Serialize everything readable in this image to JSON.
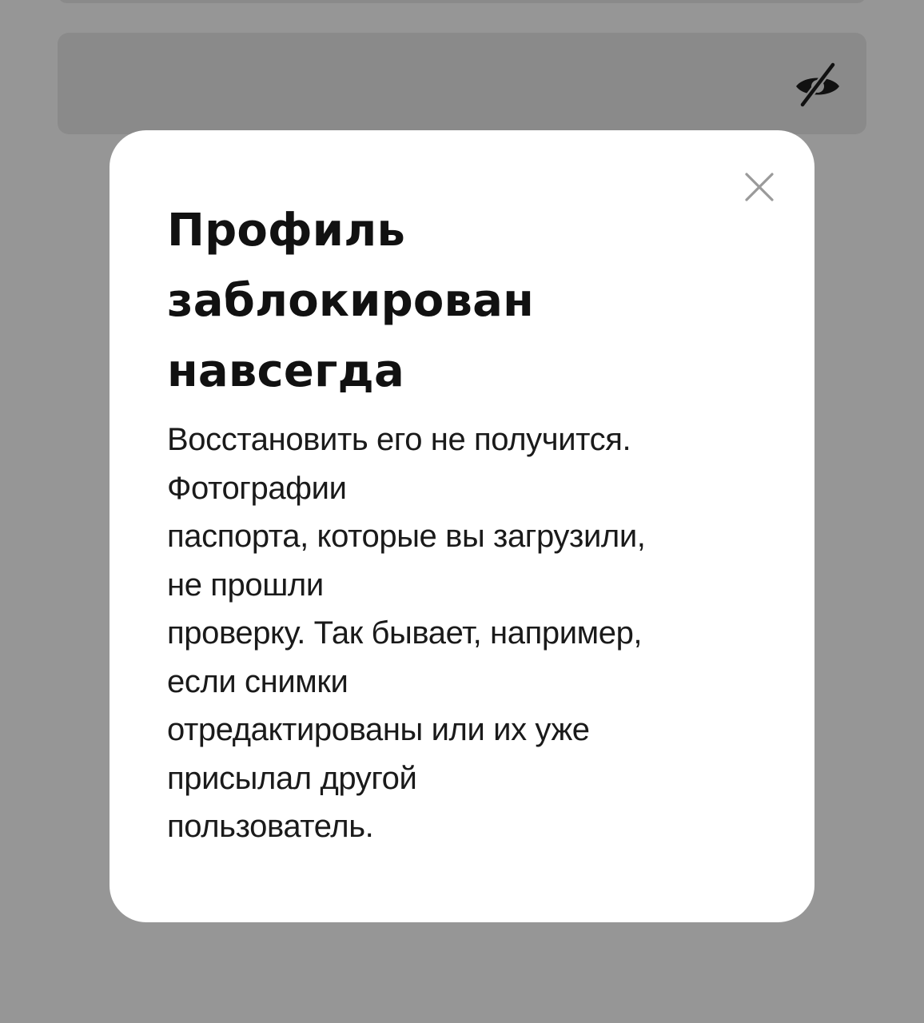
{
  "background": {
    "overlay_color": "#969696",
    "password_field": {
      "visibility_toggle_icon": "eye-off-icon"
    }
  },
  "modal": {
    "close_icon": "close-icon",
    "title": "Профиль заблокирован навсегда",
    "body_lines": [
      "Восстановить его не получится.",
      "Фотографии",
      "паспорта, которые вы загрузили,",
      "не прошли",
      "проверку. Так бывает, например,",
      "если снимки",
      "отредактированы или их уже",
      "присылал другой",
      "пользователь."
    ]
  }
}
